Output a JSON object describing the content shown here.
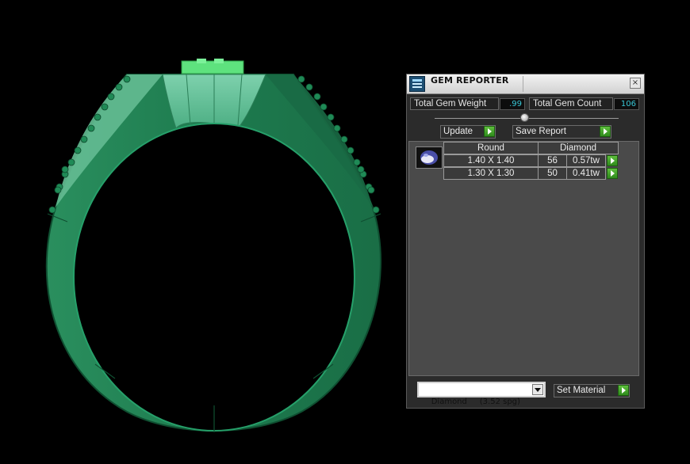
{
  "panel": {
    "title": "GEM REPORTER",
    "close_glyph": "×",
    "total_gem_weight_label": "Total Gem Weight",
    "total_gem_weight_value": ".99",
    "total_gem_count_label": "Total Gem Count",
    "total_gem_count_value": "106",
    "update_label": "Update",
    "save_report_label": "Save Report",
    "table": {
      "headers": [
        "Round",
        "Diamond"
      ],
      "rows": [
        {
          "size": "1.40 X 1.40",
          "count": "56",
          "weight": "0.57tw"
        },
        {
          "size": "1.30 X 1.30",
          "count": "50",
          "weight": "0.41tw"
        }
      ]
    },
    "material_select": {
      "value": "Diamond     (3.52 spg)"
    },
    "set_material_label": "Set Material"
  },
  "icons": {
    "app": "gem-reporter-app-icon",
    "gem": "round-gem-icon",
    "go": "green-play-arrow-icon"
  },
  "colors": {
    "ring": "#1f8f5b",
    "ring_highlight": "#6fc7a0",
    "background": "#000000",
    "value_text": "#38c7d6",
    "go_button": "#3fa428"
  }
}
